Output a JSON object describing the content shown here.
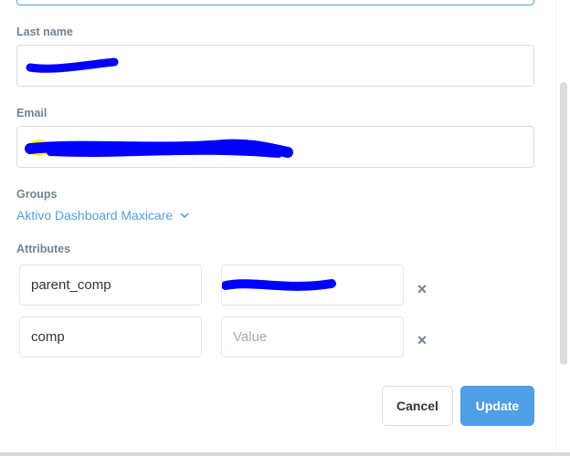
{
  "form": {
    "last_name_label": "Last name",
    "email_label": "Email",
    "groups_label": "Groups",
    "groups_value": "Aktivo Dashboard Maxicare",
    "attributes_label": "Attributes",
    "attributes": [
      {
        "key": "parent_comp",
        "value": ""
      },
      {
        "key": "comp",
        "value_placeholder": "Value"
      }
    ]
  },
  "actions": {
    "cancel_label": "Cancel",
    "update_label": "Update"
  },
  "colors": {
    "accent": "#509ee3",
    "redaction": "#0000ff",
    "highlight": "#ffff00"
  },
  "icons": {
    "groups_dropdown": "chevron-down-icon",
    "remove_attribute": "close-icon"
  }
}
